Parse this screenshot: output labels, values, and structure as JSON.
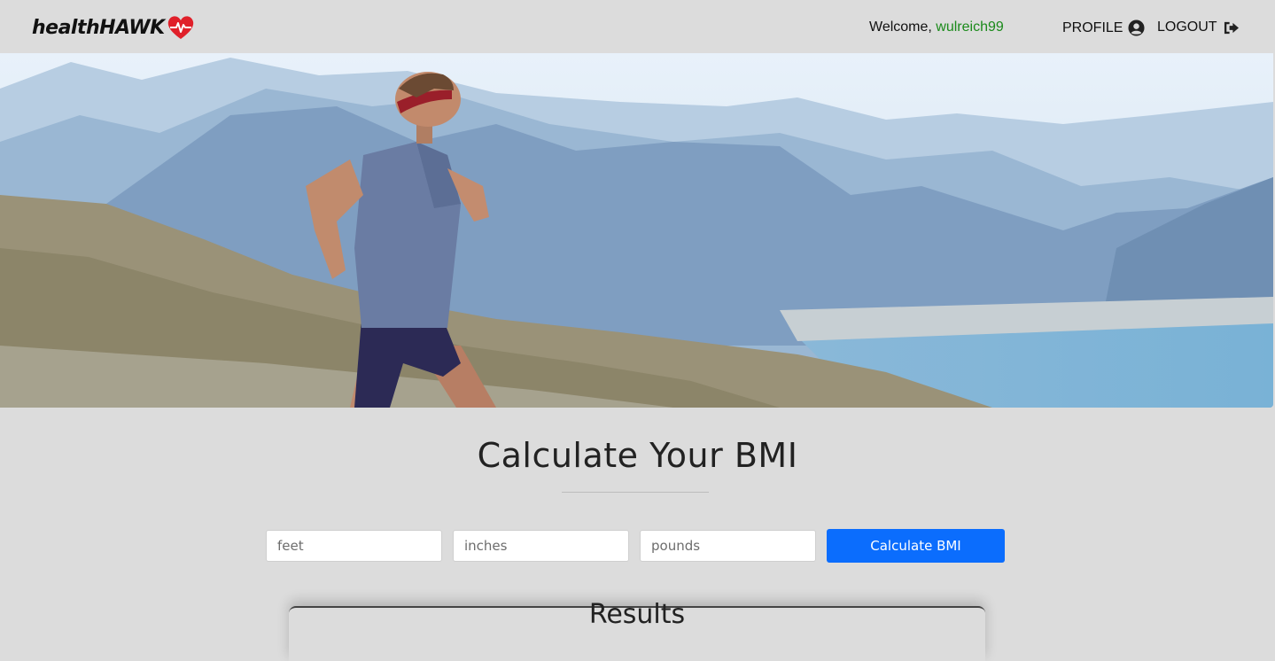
{
  "navbar": {
    "brand": "healthHAWK",
    "welcome_prefix": "Welcome, ",
    "username": "wulreich99",
    "profile_label": "PROFILE",
    "logout_label": "LOGOUT",
    "icons": [
      "heart-pulse-icon",
      "user-circle-icon",
      "sign-out-icon"
    ]
  },
  "hero": {
    "image": "runner-mountains-lake-photo"
  },
  "main": {
    "title": "Calculate Your BMI",
    "form": {
      "feet_placeholder": "feet",
      "inches_placeholder": "inches",
      "pounds_placeholder": "pounds",
      "submit_label": "Calculate BMI"
    },
    "results_title": "Results"
  },
  "colors": {
    "background": "#dcdcdc",
    "accent": "#0b6dfd",
    "username": "#1a8a1a",
    "heart": "#e0202a"
  }
}
